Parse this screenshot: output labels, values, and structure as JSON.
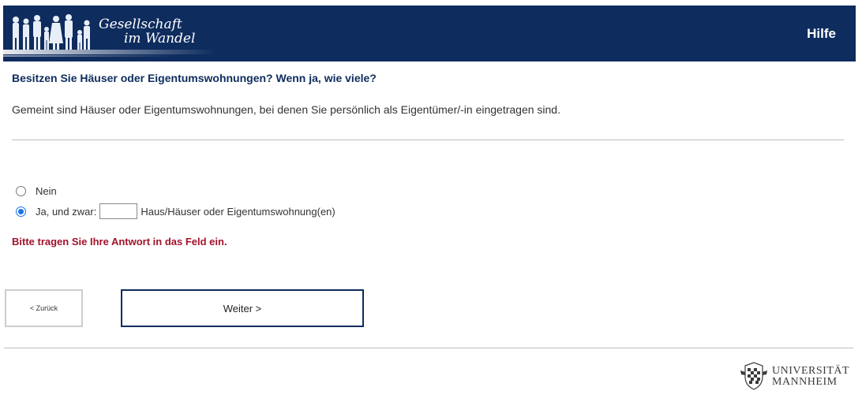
{
  "header": {
    "brand_line1": "Gesellschaft",
    "brand_line2": "im Wandel",
    "help_label": "Hilfe",
    "background_color": "#0e2c5e"
  },
  "question": {
    "title": "Besitzen Sie Häuser oder Eigentumswohnungen? Wenn ja, wie viele?",
    "explanation": "Gemeint sind Häuser oder Eigentumswohnungen, bei denen Sie persönlich als Eigentümer/-in eingetragen sind."
  },
  "options": [
    {
      "label": "Nein",
      "selected": false
    },
    {
      "label": "Ja, und zwar:",
      "selected": true,
      "input_value": "",
      "suffix": "Haus/Häuser oder Eigentumswohnung(en)"
    }
  ],
  "error_message": "Bitte tragen Sie Ihre Antwort in das Feld ein.",
  "error_color": "#a3122b",
  "navigation": {
    "back_label": "< Zurück",
    "next_label": "Weiter >"
  },
  "footer": {
    "university_line1": "UNIVERSITÄT",
    "university_line2": "MANNHEIM"
  },
  "icons": {
    "logo": "people-silhouettes-logo",
    "seal": "university-seal-icon"
  }
}
